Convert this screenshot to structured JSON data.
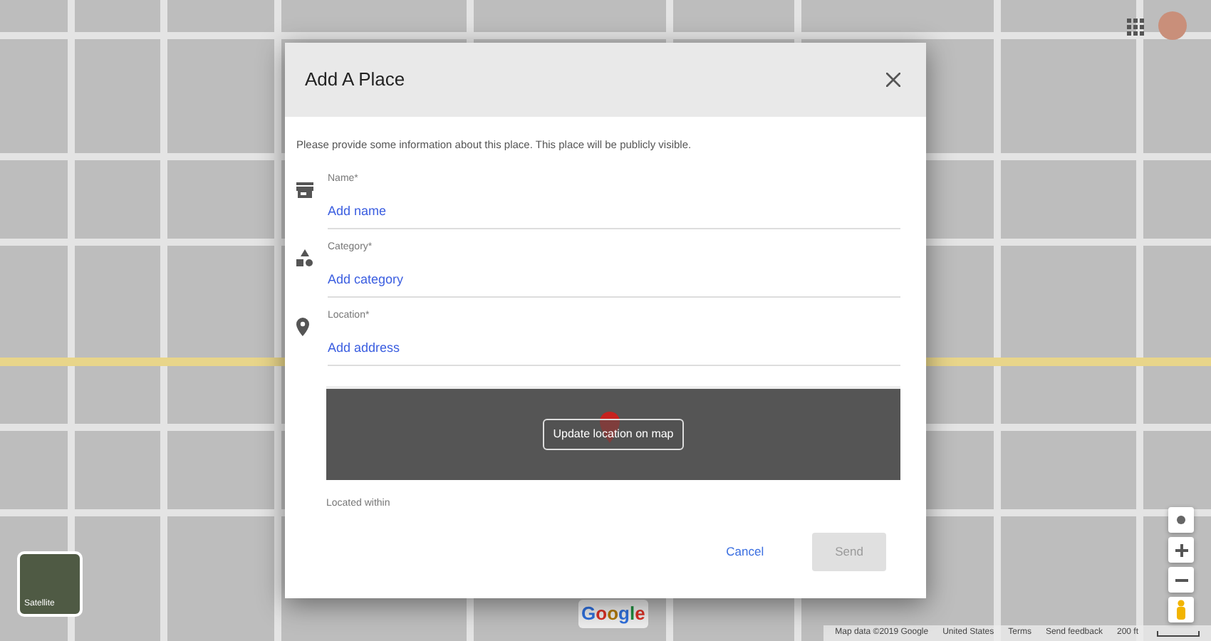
{
  "map": {
    "logo": "Google",
    "layer_toggle": "Satellite",
    "attribution": "Map data ©2019 Google",
    "links": [
      "United States",
      "Terms",
      "Send feedback"
    ],
    "scale": "200 ft"
  },
  "dialog": {
    "title": "Add A Place",
    "intro": "Please provide some information about this place. This place will be publicly visible.",
    "fields": [
      {
        "kind": "store",
        "label": "Name*",
        "placeholder": "Add name"
      },
      {
        "kind": "category",
        "label": "Category*",
        "placeholder": "Add category"
      },
      {
        "kind": "pin",
        "label": "Location*",
        "placeholder": "Add address"
      }
    ],
    "location_button": "Update location on map",
    "located_within": "Located within",
    "buttons": [
      {
        "label": "Cancel",
        "disabled": false
      },
      {
        "label": "Send",
        "disabled": true
      }
    ]
  }
}
